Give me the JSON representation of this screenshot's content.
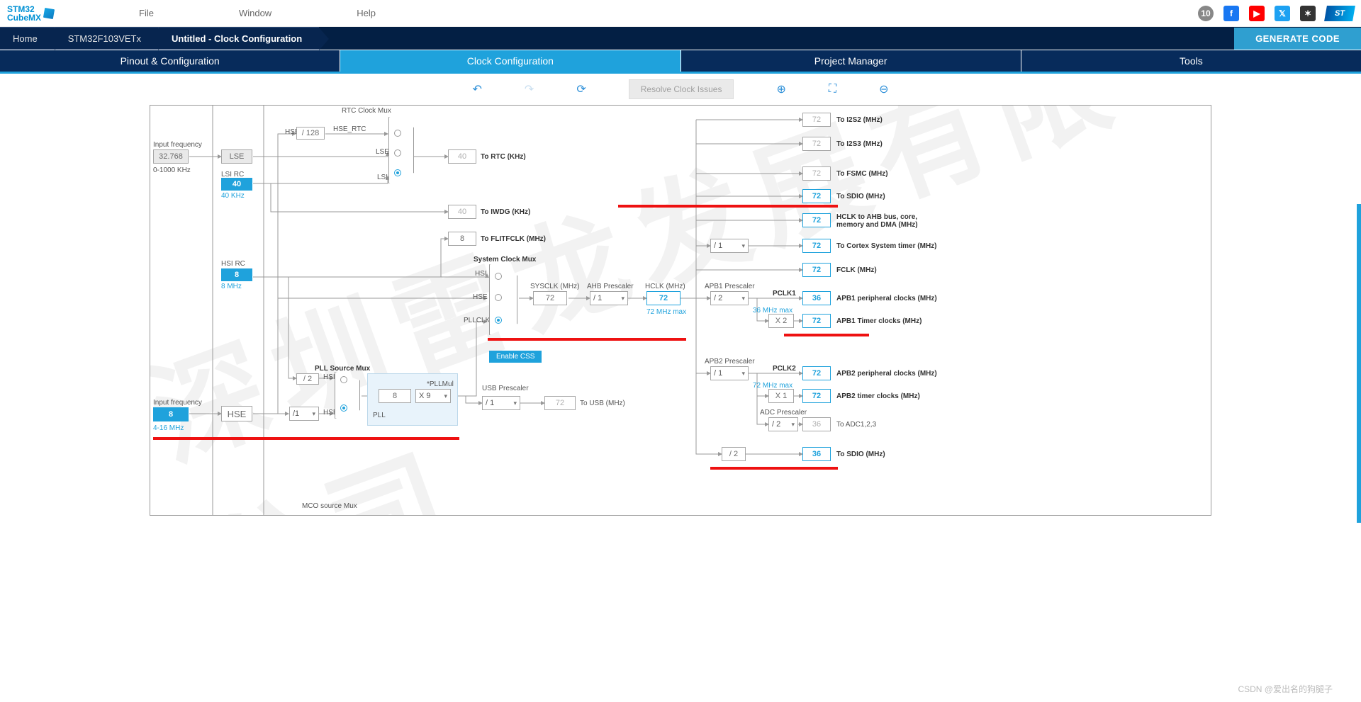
{
  "app": {
    "logo1": "STM32",
    "logo2": "CubeMX",
    "st_logo": "ST"
  },
  "menu": {
    "file": "File",
    "window": "Window",
    "help": "Help"
  },
  "breadcrumb": {
    "home": "Home",
    "chip": "STM32F103VETx",
    "page": "Untitled - Clock Configuration"
  },
  "generate": "GENERATE CODE",
  "tabs": {
    "pinout": "Pinout & Configuration",
    "clock": "Clock Configuration",
    "proj": "Project Manager",
    "tools": "Tools"
  },
  "toolbar": {
    "resolve": "Resolve Clock Issues"
  },
  "diagram": {
    "input_freq_lbl": "Input frequency",
    "lse_input_val": "32.768",
    "lse_input_range": "0-1000 KHz",
    "lse": "LSE",
    "lsi_lbl": "LSI RC",
    "lsi_val": "40",
    "lsi_hz": "40 KHz",
    "hsi_lbl": "HSI RC",
    "hsi_val": "8",
    "hsi_hz": "8 MHz",
    "hse_input_lbl": "Input frequency",
    "hse_input_val": "8",
    "hse_input_range": "4-16 MHz",
    "hse": "HSE",
    "hse_presel": "/1",
    "rtc_title": "RTC Clock Mux",
    "hse_rtc_div": "/ 128",
    "hse_rtc_lbl": "HSE_RTC",
    "hse_lbl": "HSE",
    "lse_lbl": "LSE",
    "lsi_lbl2": "LSI",
    "rtc_out": "40",
    "rtc_out_lbl": "To RTC (KHz)",
    "iwdg_out": "40",
    "iwdg_out_lbl": "To IWDG (KHz)",
    "flitf_val": "8",
    "flitf_lbl": "To FLITFCLK (MHz)",
    "sys_title": "System Clock Mux",
    "hsi": "HSI",
    "hse2": "HSE",
    "pllclk": "PLLCLK",
    "enable_css": "Enable CSS",
    "pll_src_title": "PLL Source Mux",
    "pll_lbl": "PLL",
    "pll_div2": "/ 2",
    "pllmul_lbl": "*PLLMul",
    "pllmul_in": "8",
    "pllmul_sel": "X 9",
    "usb_title": "USB Prescaler",
    "usb_sel": "/ 1",
    "usb_out": "72",
    "usb_lbl": "To USB (MHz)",
    "sysclk_lbl": "SYSCLK (MHz)",
    "sysclk_val": "72",
    "ahb_title": "AHB Prescaler",
    "ahb_sel": "/ 1",
    "hclk_lbl": "HCLK (MHz)",
    "hclk_val": "72",
    "hclk_max": "72 MHz max",
    "apb1_title": "APB1 Prescaler",
    "apb1_sel": "/ 2",
    "apb1_max": "36 MHz max",
    "pclk1_lbl": "PCLK1",
    "apb1_x2": "X 2",
    "apb2_title": "APB2 Prescaler",
    "apb2_sel": "/ 1",
    "apb2_max": "72 MHz max",
    "pclk2_lbl": "PCLK2",
    "apb2_x1": "X 1",
    "cortex_sel": "/ 1",
    "adc_title": "ADC Prescaler",
    "adc_sel": "/ 2",
    "adc_out": "36",
    "adc_lbl": "To ADC1,2,3",
    "sdio2_div": "/ 2",
    "sdio2_out": "36",
    "sdio2_lbl": "To SDIO (MHz)",
    "mco_lbl": "MCO source Mux",
    "outs": {
      "i2s2": {
        "v": "72",
        "l": "To I2S2 (MHz)"
      },
      "i2s3": {
        "v": "72",
        "l": "To I2S3 (MHz)"
      },
      "fsmc": {
        "v": "72",
        "l": "To FSMC (MHz)"
      },
      "sdio": {
        "v": "72",
        "l": "To SDIO (MHz)"
      },
      "hclk": {
        "v": "72",
        "l": "HCLK to AHB bus, core, memory and DMA (MHz)"
      },
      "cortex": {
        "v": "72",
        "l": "To Cortex System timer (MHz)"
      },
      "fclk": {
        "v": "72",
        "l": "FCLK (MHz)"
      },
      "apb1p": {
        "v": "36",
        "l": "APB1 peripheral clocks (MHz)"
      },
      "apb1t": {
        "v": "72",
        "l": "APB1 Timer clocks (MHz)"
      },
      "apb2p": {
        "v": "72",
        "l": "APB2 peripheral clocks (MHz)"
      },
      "apb2t": {
        "v": "72",
        "l": "APB2 timer clocks (MHz)"
      }
    }
  },
  "footer": "CSDN @爱出名的狗腿子",
  "watermark": "深圳雷龙发展有限公司"
}
